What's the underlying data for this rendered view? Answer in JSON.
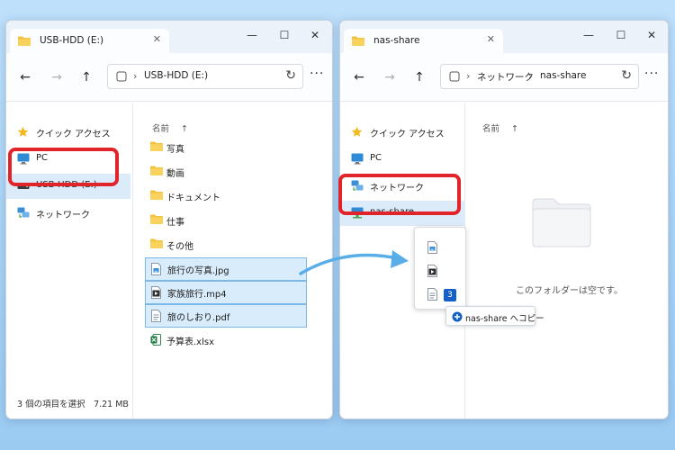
{
  "left_window": {
    "tab_title": "USB-HDD (E:)",
    "tab_close": "✕",
    "caption": {
      "minimize": "—",
      "maximize": "☐",
      "close": "✕"
    },
    "breadcrumb": [
      "USB-HDD (E:)"
    ],
    "sidebar": [
      {
        "label": "クイック アクセス",
        "icon": "star-icon"
      },
      {
        "label": "PC",
        "icon": "monitor-icon"
      },
      {
        "label": "USB-HDD (E:)",
        "icon": "drive-icon",
        "selected": true
      },
      {
        "label": "ネットワーク",
        "icon": "network-icon"
      }
    ],
    "column_header": "名前",
    "sort_arrow": "↑",
    "files": [
      {
        "name": "写真",
        "icon": "folder-icon",
        "selected": false
      },
      {
        "name": "動画",
        "icon": "folder-icon",
        "selected": false
      },
      {
        "name": "ドキュメント",
        "icon": "folder-icon",
        "selected": false
      },
      {
        "name": "仕事",
        "icon": "folder-icon",
        "selected": false
      },
      {
        "name": "その他",
        "icon": "folder-icon",
        "selected": false
      },
      {
        "name": "旅行の写真.jpg",
        "icon": "image-file-icon",
        "selected": true
      },
      {
        "name": "家族旅行.mp4",
        "icon": "video-file-icon",
        "selected": true
      },
      {
        "name": "旅のしおり.pdf",
        "icon": "document-file-icon",
        "selected": true
      },
      {
        "name": "予算表.xlsx",
        "icon": "excel-file-icon",
        "selected": false
      }
    ],
    "status": "3 個の項目を選択　7.21 MB"
  },
  "right_window": {
    "tab_title": "nas-share",
    "tab_close": "✕",
    "caption": {
      "minimize": "—",
      "maximize": "☐",
      "close": "✕"
    },
    "breadcrumb": [
      "ネットワーク",
      "nas-share"
    ],
    "sidebar": [
      {
        "label": "クイック アクセス",
        "icon": "star-icon"
      },
      {
        "label": "PC",
        "icon": "monitor-icon"
      },
      {
        "label": "ネットワーク",
        "icon": "network-icon"
      },
      {
        "label": "nas-share",
        "icon": "network-drive-icon",
        "selected": true
      }
    ],
    "column_header": "名前",
    "sort_arrow": "↑",
    "empty_message": "このフォルダーは空です。"
  },
  "drag": {
    "count": "3",
    "tooltip": "nas-share へコピー",
    "icons": [
      "image-file-icon",
      "video-file-icon",
      "document-file-icon"
    ]
  },
  "nav": {
    "back": "←",
    "forward": "→",
    "up": "↑",
    "chevron": "›",
    "refresh": "↻",
    "more": "···"
  },
  "colors": {
    "highlight": "#e0242a",
    "selection_fill": "#d8ecfb",
    "selection_border": "#7db8e6",
    "folder": "#f2c23c",
    "count_badge": "#1560c8",
    "arrow": "#5aaee8"
  }
}
